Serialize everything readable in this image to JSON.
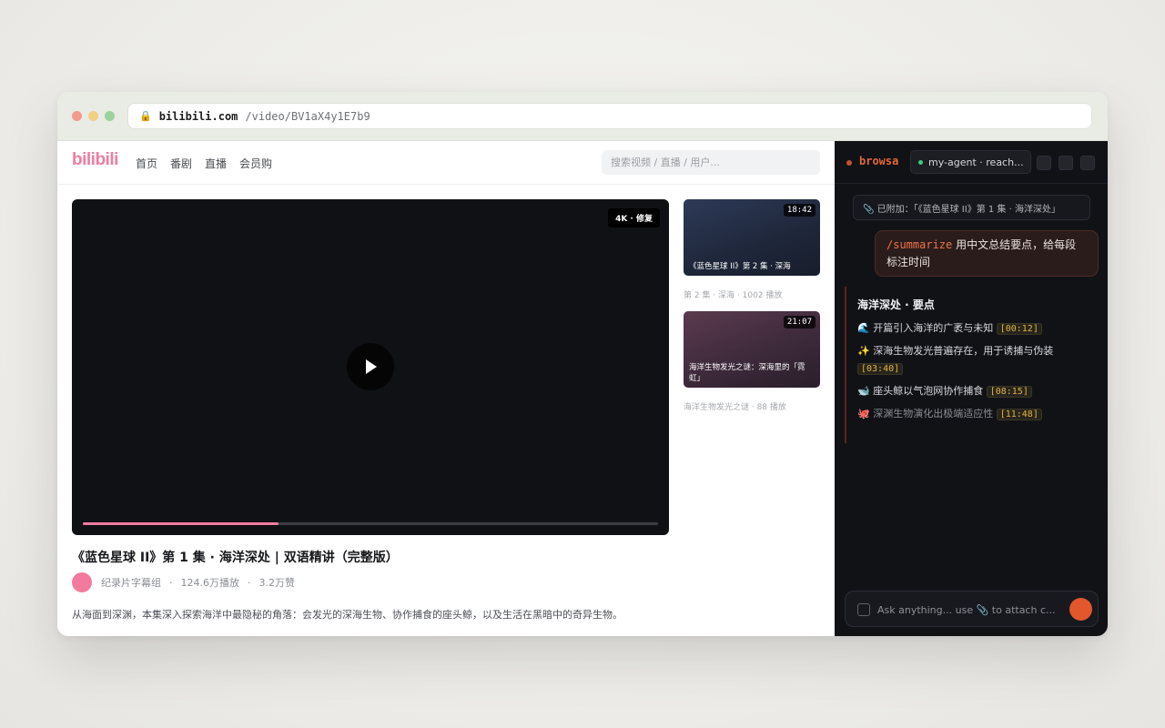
{
  "browser": {
    "url_domain": "bilibili.com",
    "url_path": "/video/BV1aX4y1E7b9"
  },
  "site": {
    "logo": "bilibili",
    "nav": [
      "首页",
      "番剧",
      "直播",
      "会员购"
    ],
    "search_placeholder": "搜索视频 / 直播 / 用户..."
  },
  "player": {
    "quality_badge": "4K · 修复",
    "progress": 0.34
  },
  "video": {
    "title": "《蓝色星球 II》第 1 集 · 海洋深处 | 双语精讲（完整版）",
    "uploader": "纪录片字幕组",
    "plays": "124.6万播放",
    "likes": "3.2万赞",
    "description": "从海面到深渊，本集深入探索海洋中最隐秘的角落：会发光的深海生物、协作捕食的座头鲸，以及生活在黑暗中的奇异生物。"
  },
  "recommendations": [
    {
      "duration": "18:42",
      "caption": "《蓝色星球 II》第 2 集 · 深海",
      "sub": "第 2 集 · 深海 · 1002 播放"
    },
    {
      "duration": "21:07",
      "caption": "海洋生物发光之谜：深海里的「霓虹」",
      "sub": "海洋生物发光之谜 · 88 播放"
    }
  ],
  "panel": {
    "brand": "browsa",
    "agent": "my-agent · reach...",
    "attached": "📎 已附加：「《蓝色星球 II》第 1 集 · 海洋深处」",
    "user_cmd": "/summarize",
    "user_text": "用中文总结要点，给每段标注时间",
    "reply_title": "海洋深处 · 要点",
    "points": [
      {
        "emoji": "🌊",
        "text": "开篇引入海洋的广袤与未知",
        "ts": "[00:12]"
      },
      {
        "emoji": "✨",
        "text": "深海生物发光普遍存在，用于诱捕与伪装",
        "ts": "[03:40]"
      },
      {
        "emoji": "🐋",
        "text": "座头鲸以气泡网协作捕食",
        "ts": "[08:15]"
      },
      {
        "emoji": "🐙",
        "text": "深渊生物演化出极端适应性",
        "ts": "[11:48]"
      }
    ],
    "composer_placeholder": "Ask anything... use 📎 to attach c..."
  },
  "colors": {
    "brand_pink": "#f07ca0",
    "browsa_orange": "#e4683a",
    "timestamp": "#e3b341",
    "send": "#e2572b"
  }
}
